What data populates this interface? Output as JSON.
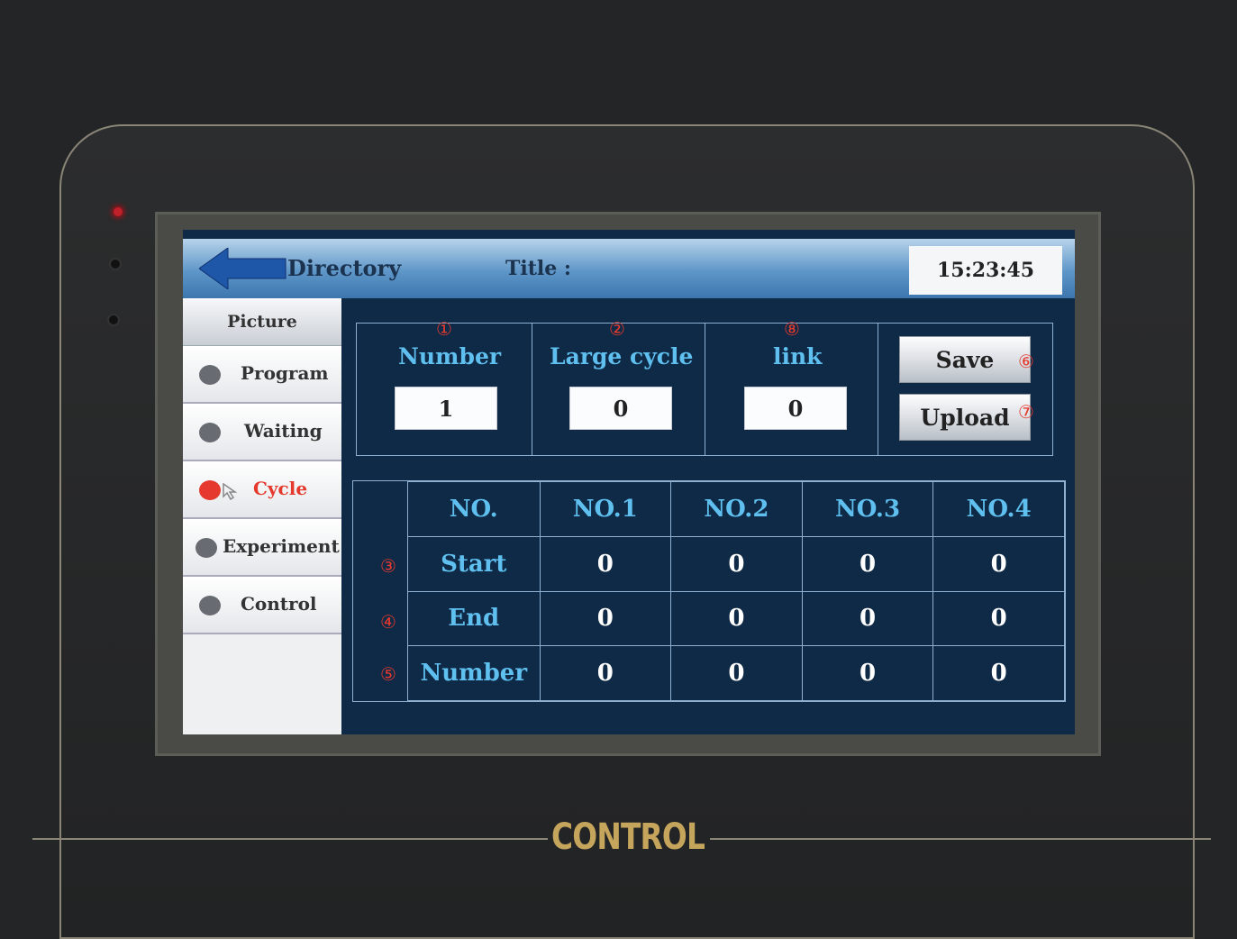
{
  "header": {
    "back_label": "Directory",
    "title_label": "Title :",
    "clock": "15:23:45"
  },
  "sidebar": {
    "header": "Picture",
    "items": [
      {
        "label": "Program",
        "active": false
      },
      {
        "label": "Waiting",
        "active": false
      },
      {
        "label": "Cycle",
        "active": true
      },
      {
        "label": "Experiment",
        "active": false
      },
      {
        "label": "Control",
        "active": false
      }
    ]
  },
  "fields": [
    {
      "marker": "①",
      "label": "Number",
      "value": "1"
    },
    {
      "marker": "②",
      "label": "Large cycle",
      "value": "0"
    },
    {
      "marker": "⑧",
      "label": "link",
      "value": "0"
    }
  ],
  "actions": [
    {
      "label": "Save",
      "marker": "⑥"
    },
    {
      "label": "Upload",
      "marker": "⑦"
    }
  ],
  "table": {
    "columns": [
      "NO.",
      "NO.1",
      "NO.2",
      "NO.3",
      "NO.4"
    ],
    "rows": [
      {
        "marker": "③",
        "label": "Start",
        "values": [
          "0",
          "0",
          "0",
          "0"
        ]
      },
      {
        "marker": "④",
        "label": "End",
        "values": [
          "0",
          "0",
          "0",
          "0"
        ]
      },
      {
        "marker": "⑤",
        "label": "Number",
        "values": [
          "0",
          "0",
          "0",
          "0"
        ]
      }
    ]
  },
  "device": {
    "brand": "CONTROL"
  },
  "colors": {
    "accent_cyan": "#5fc0f0",
    "active_red": "#e5392d",
    "screen_bg": "#0f2a47"
  }
}
